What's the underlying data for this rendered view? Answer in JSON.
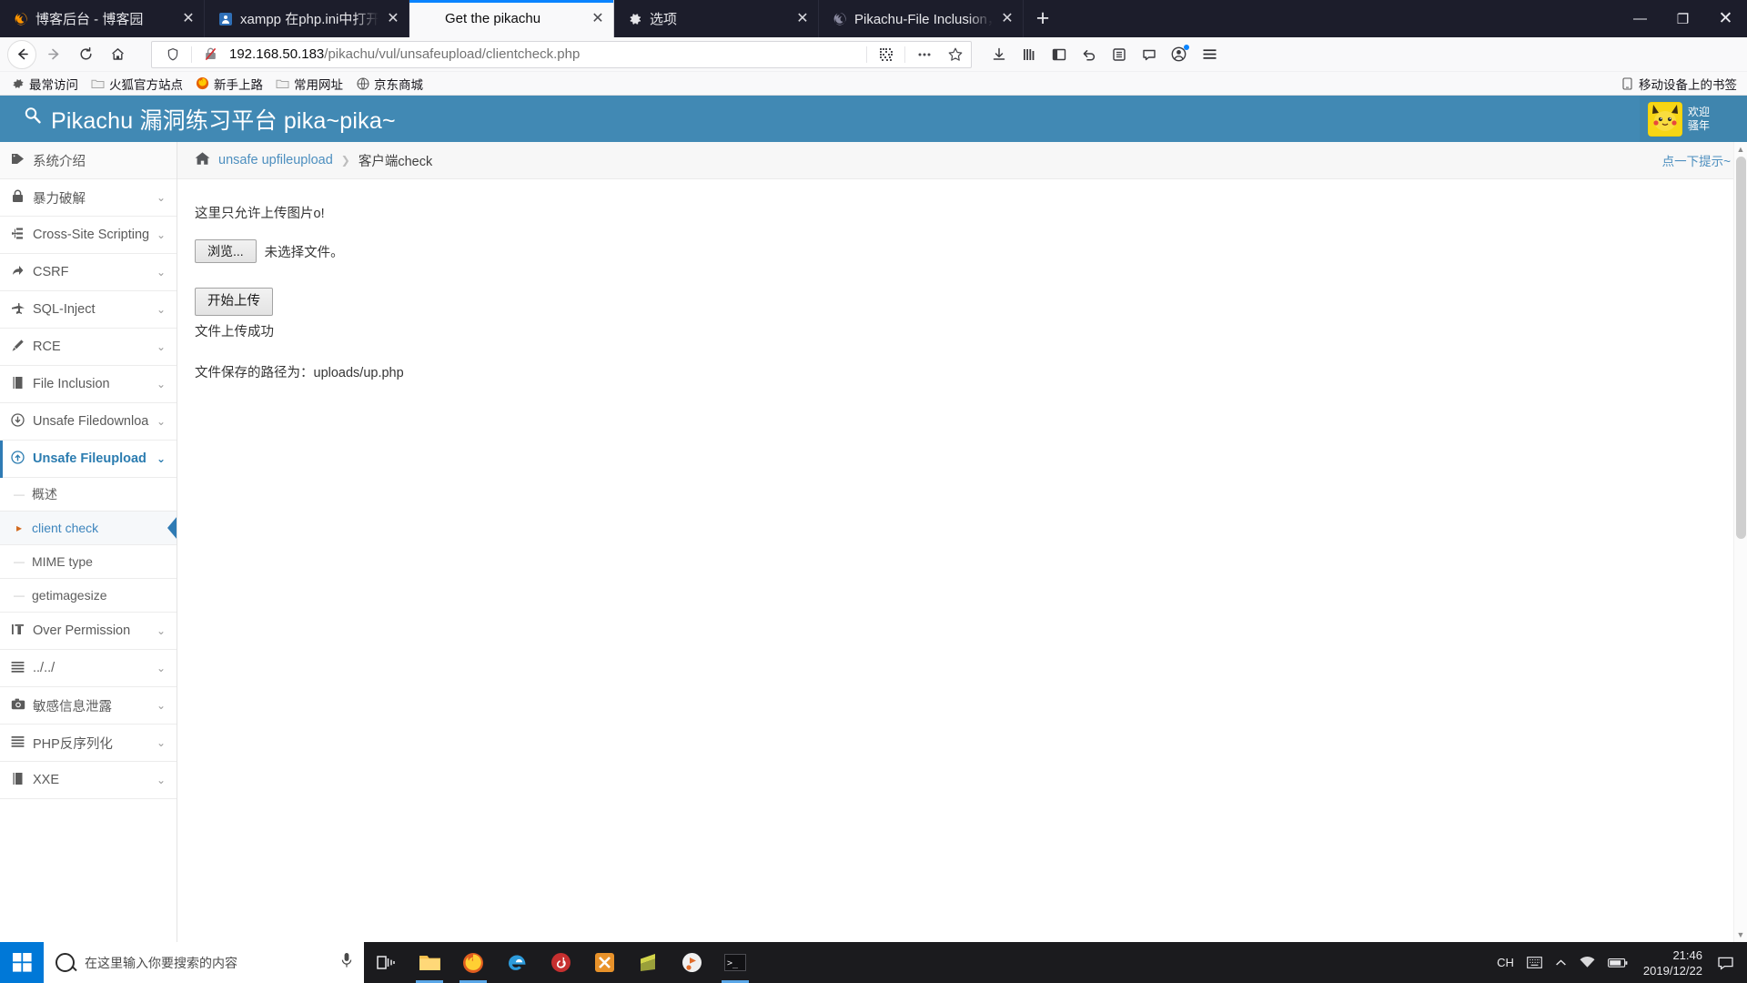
{
  "browser": {
    "tabs": [
      {
        "title": "博客后台 - 博客园",
        "favicon": "firefox-icon",
        "active": false,
        "close_label": "✕"
      },
      {
        "title": "xampp 在php.ini中打开了再重",
        "favicon": "xampp-icon",
        "active": false,
        "close_label": "✕"
      },
      {
        "title": "Get the pikachu",
        "favicon": "none",
        "active": true,
        "close_label": "✕"
      },
      {
        "title": "选项",
        "favicon": "gear-icon",
        "active": false,
        "close_label": "✕"
      },
      {
        "title": "Pikachu-File Inclusion，Uns",
        "favicon": "firefox-icon",
        "active": false,
        "close_label": "✕"
      }
    ],
    "new_tab_label": "+",
    "window_controls": {
      "minimize": "—",
      "maximize": "❐",
      "close": "✕"
    },
    "nav": {
      "back": "←",
      "forward": "→",
      "reload": "⟳",
      "home": "⌂",
      "url_host": "192.168.50.183",
      "url_path": "/pikachu/vul/unsafeupload/clientcheck.php",
      "shield_icon": "shield-icon",
      "page_info_icon": "broken-lock-icon",
      "qr_icon": "qr-code-icon",
      "more_icon": "ellipsis-icon",
      "bookmark_icon": "star-icon"
    },
    "toolbar_icons": [
      {
        "name": "downloads-icon",
        "glyph": "⭳"
      },
      {
        "name": "library-icon",
        "glyph": "||||"
      },
      {
        "name": "sidebar-icon",
        "glyph": "▯"
      },
      {
        "name": "undo-icon",
        "glyph": "↶"
      },
      {
        "name": "pocket-icon",
        "glyph": "⌗"
      },
      {
        "name": "chat-icon",
        "glyph": "❑"
      },
      {
        "name": "account-icon",
        "glyph": "◉"
      }
    ],
    "menu_icon": "hamburger-icon",
    "bookmarks": [
      {
        "label": "最常访问",
        "icon": "gear-icon"
      },
      {
        "label": "火狐官方站点",
        "icon": "folder-icon"
      },
      {
        "label": "新手上路",
        "icon": "firefox-icon"
      },
      {
        "label": "常用网址",
        "icon": "folder-icon"
      },
      {
        "label": "京东商城",
        "icon": "globe-icon"
      }
    ],
    "bookmarks_right": {
      "label": "移动设备上的书签",
      "icon": "mobile-icon"
    }
  },
  "site": {
    "header": {
      "title": "Pikachu 漏洞练习平台 pika~pika~",
      "logo_icon": "magnifier-icon",
      "user": {
        "line1": "欢迎",
        "line2": "骚年",
        "avatar_icon": "pikachu-avatar"
      }
    },
    "sidebar": {
      "items": [
        {
          "label": "系统介绍",
          "icon": "tag-icon",
          "chevron": false,
          "active": false
        },
        {
          "label": "暴力破解",
          "icon": "lock-icon",
          "chevron": true,
          "active": false
        },
        {
          "label": "Cross-Site Scripting",
          "icon": "sitemap-icon",
          "chevron": true,
          "active": false
        },
        {
          "label": "CSRF",
          "icon": "share-icon",
          "chevron": true,
          "active": false
        },
        {
          "label": "SQL-Inject",
          "icon": "plane-icon",
          "chevron": true,
          "active": false
        },
        {
          "label": "RCE",
          "icon": "pencil-icon",
          "chevron": true,
          "active": false
        },
        {
          "label": "File Inclusion",
          "icon": "book-icon",
          "chevron": true,
          "active": false
        },
        {
          "label": "Unsafe Filedownload",
          "icon": "download-circle-icon",
          "chevron": true,
          "active": false
        },
        {
          "label": "Unsafe Fileupload",
          "icon": "upload-circle-icon",
          "chevron": true,
          "active": true
        }
      ],
      "sub_items": [
        {
          "label": "概述",
          "current": false
        },
        {
          "label": "client check",
          "current": true
        },
        {
          "label": "MIME type",
          "current": false
        },
        {
          "label": "getimagesize",
          "current": false
        }
      ],
      "items_after": [
        {
          "label": "Over Permission",
          "icon": "id-icon",
          "chevron": true
        },
        {
          "label": "../../",
          "icon": "list-icon",
          "chevron": true
        },
        {
          "label": "敏感信息泄露",
          "icon": "camera-icon",
          "chevron": true
        },
        {
          "label": "PHP反序列化",
          "icon": "list-icon",
          "chevron": true
        },
        {
          "label": "XXE",
          "icon": "book-icon",
          "chevron": true
        }
      ]
    },
    "breadcrumb": {
      "home_icon": "home-icon",
      "link": "unsafe upfileupload",
      "separator": "❯",
      "current": "客户端check",
      "hint": "点一下提示~"
    },
    "main": {
      "notice": "这里只允许上传图片o!",
      "browse_button": "浏览...",
      "file_status": "未选择文件。",
      "upload_button": "开始上传",
      "success_msg": "文件上传成功",
      "path_msg": "文件保存的路径为：uploads/up.php"
    }
  },
  "taskbar": {
    "start_icon": "windows-icon",
    "search_placeholder": "在这里输入你要搜索的内容",
    "mic_icon": "microphone-icon",
    "task_view_icon": "task-view-icon",
    "pinned": [
      {
        "name": "file-explorer-icon",
        "glyph": "🗀",
        "color": "#f5c04e",
        "running": true
      },
      {
        "name": "firefox-icon",
        "glyph": "◉",
        "color": "#e66000",
        "running": true
      },
      {
        "name": "edge-icon",
        "glyph": "e",
        "color": "#2d9bdb",
        "running": false
      },
      {
        "name": "netease-music-icon",
        "glyph": "◉",
        "color": "#c62f2f",
        "running": false
      },
      {
        "name": "xampp-icon",
        "glyph": "✖",
        "color": "#e8922a",
        "running": false
      },
      {
        "name": "sublime-icon",
        "glyph": "S",
        "color": "#d3d54a",
        "running": false
      },
      {
        "name": "burpsuite-icon",
        "glyph": "♪",
        "color": "#e06c2b",
        "running": false
      },
      {
        "name": "terminal-icon",
        "glyph": "▮",
        "color": "#1f1f22",
        "running": true
      }
    ],
    "tray": {
      "ime": "CH",
      "keyboard_icon": "keyboard-icon",
      "chevron_icon": "chevron-up-icon",
      "network_icon": "wifi-icon",
      "battery_icon": "battery-icon",
      "time": "21:46",
      "date": "2019/12/22",
      "notification_icon": "notification-icon"
    }
  },
  "colors": {
    "tab_strip": "#1c1d2b",
    "accent_blue": "#0a84ff",
    "pika_header": "#4189b4",
    "link_blue": "#4d8fbf",
    "taskbar": "#1b1b1e",
    "start_blue": "#0078d7"
  }
}
